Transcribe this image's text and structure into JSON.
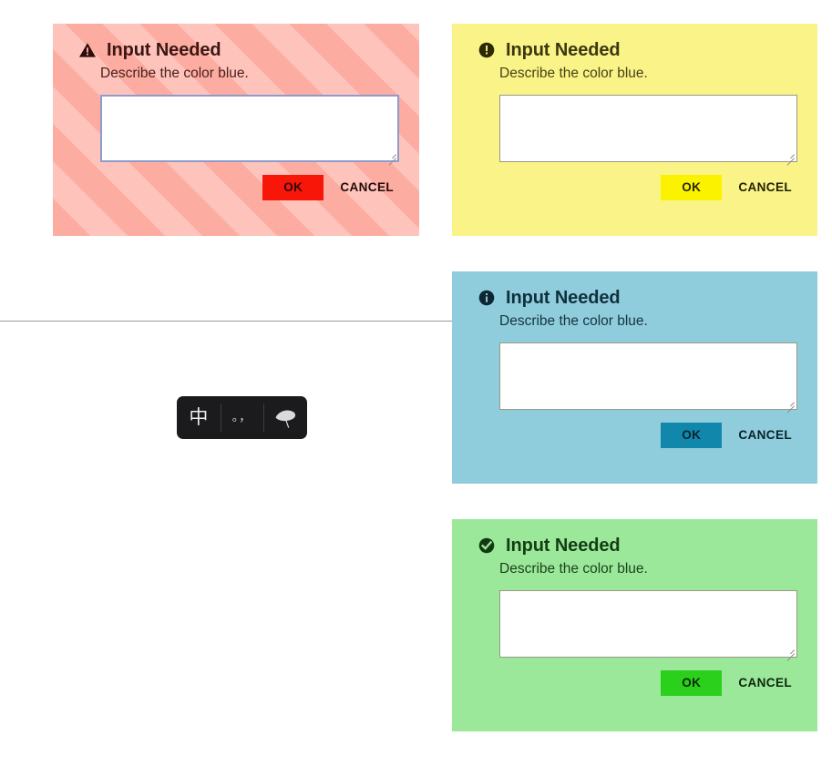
{
  "background": {
    "divider_name": "horizontal-rule",
    "page_background": "#ffffff",
    "divider_color": "#9a9a9a"
  },
  "dialogs": [
    {
      "id": "warning",
      "icon": "warning-triangle-icon",
      "title": "Input Needed",
      "message": "Describe the color blue.",
      "textarea_value": "",
      "textarea_placeholder": "",
      "focused": true,
      "ok_label": "OK",
      "cancel_label": "CANCEL",
      "surface_color": "#fdbdb4",
      "stripe_color": "#fcaca1",
      "accent_color": "#f71608"
    },
    {
      "id": "caution",
      "icon": "exclamation-circle-icon",
      "title": "Input Needed",
      "message": "Describe the color blue.",
      "textarea_value": "",
      "textarea_placeholder": "",
      "focused": false,
      "ok_label": "OK",
      "cancel_label": "CANCEL",
      "surface_color": "#faf387",
      "accent_color": "#fbf200"
    },
    {
      "id": "info",
      "icon": "info-circle-icon",
      "title": "Input Needed",
      "message": "Describe the color blue.",
      "textarea_value": "",
      "textarea_placeholder": "",
      "focused": false,
      "ok_label": "OK",
      "cancel_label": "CANCEL",
      "surface_color": "#8fcddd",
      "accent_color": "#1187ac"
    },
    {
      "id": "success",
      "icon": "check-circle-icon",
      "title": "Input Needed",
      "message": "Describe the color blue.",
      "textarea_value": "",
      "textarea_placeholder": "",
      "focused": false,
      "ok_label": "OK",
      "cancel_label": "CANCEL",
      "surface_color": "#9ce89b",
      "accent_color": "#2ad01b"
    }
  ],
  "ime_toolbar": {
    "background_color": "#1b1b1d",
    "items": [
      {
        "icon": "chinese-mode-icon",
        "glyph": "中",
        "label": "中"
      },
      {
        "icon": "punctuation-mode-icon",
        "glyph": "。，",
        "label": "。，"
      },
      {
        "icon": "leaf-icon",
        "glyph": "",
        "label": "leaf"
      }
    ]
  }
}
